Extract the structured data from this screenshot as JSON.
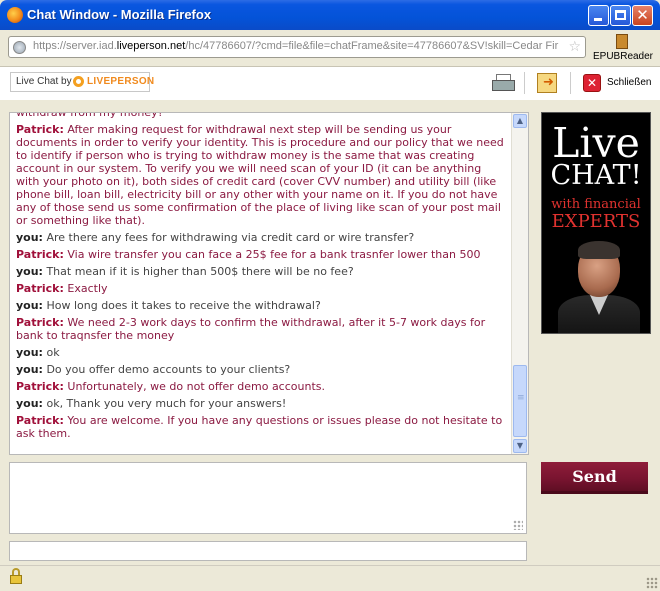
{
  "window": {
    "title": "Chat Window - Mozilla Firefox"
  },
  "browser": {
    "url_prefix": "https://server.iad.",
    "url_domain": "liveperson.net",
    "url_rest": "/hc/47786607/?cmd=file&file=chatFrame&site=47786607&SV!skill=Cedar Fir",
    "epub_label": "EPUBReader",
    "icons": {
      "site": "globe-icon",
      "bookmark": "star-icon",
      "epub": "book-icon"
    }
  },
  "toolbar": {
    "live_chat_by": "Live Chat by",
    "liveperson": "LIVEPERSON",
    "close_label": "Schließen",
    "icons": {
      "print": "printer-icon",
      "export": "export-icon",
      "close": "close-icon"
    }
  },
  "chat": {
    "messages": [
      {
        "who": "Patrick:",
        "role": "agent",
        "text": " withdraw from my money?",
        "partial": true
      },
      {
        "who": "Patrick:",
        "role": "agent",
        "text": " After making request for withdrawal next step will be sending us your documents in order to verify your identity. This is procedure and our policy that we need to identify if person who is trying to withdraw money is the same that was creating account in our system. To verify you we will need scan of your ID (it can be anything with your photo on it), both sides of credit card (cover CVV number) and utility bill (like phone bill, loan bill, electricity bill or any other with your name on it. If you do not have any of those send us some confirmation of the place of living like scan of your post mail or something like that)."
      },
      {
        "who": "you:",
        "role": "user",
        "text": " Are there any fees for withdrawing via credit card or wire transfer?"
      },
      {
        "who": "Patrick:",
        "role": "agent",
        "text": " Via wire transfer you can face a 25$ fee for a bank trasnfer lower than 500"
      },
      {
        "who": "you:",
        "role": "user",
        "text": " That mean if it is higher than 500$ there will be no fee?"
      },
      {
        "who": "Patrick:",
        "role": "agent",
        "text": " Exactly"
      },
      {
        "who": "you:",
        "role": "user",
        "text": " How long does it takes to receive the withdrawal?"
      },
      {
        "who": "Patrick:",
        "role": "agent",
        "text": " We need 2-3 work days to confirm the withdrawal, after it 5-7 work days for bank to traqnsfer the money"
      },
      {
        "who": "you:",
        "role": "user",
        "text": " ok"
      },
      {
        "who": "you:",
        "role": "user",
        "text": " Do you offer demo accounts to your clients?"
      },
      {
        "who": "Patrick:",
        "role": "agent",
        "text": " Unfortunately, we do not offer demo accounts."
      },
      {
        "who": "you:",
        "role": "user",
        "text": " ok, Thank you very much for your answers!"
      },
      {
        "who": "Patrick:",
        "role": "agent",
        "text": " You are welcome. If you have any questions or issues please do not hesitate to ask them."
      }
    ],
    "scroll_position": 0.92
  },
  "ad": {
    "line1": "Live",
    "line2": "CHAT!",
    "line3": "with financial",
    "line4": "EXPERTS"
  },
  "composer": {
    "message_value": "",
    "send_label": "Send",
    "email_value": ""
  },
  "status": {
    "icons": {
      "lock": "lock-icon"
    }
  },
  "colors": {
    "agent": "#a0103a",
    "send_button": "#7a1430",
    "titlebar": "#0453d8"
  }
}
